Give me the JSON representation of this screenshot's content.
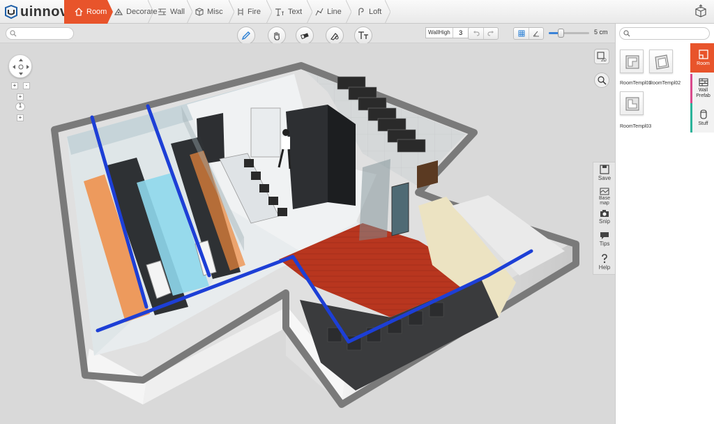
{
  "app": {
    "name": "uinnova"
  },
  "tabs": [
    {
      "label": "Room",
      "icon": "home-icon",
      "active": true
    },
    {
      "label": "Decorate",
      "icon": "decorate-icon",
      "active": false
    },
    {
      "label": "Wall",
      "icon": "wall-icon",
      "active": false
    },
    {
      "label": "Misc",
      "icon": "cube-icon",
      "active": false
    },
    {
      "label": "Fire",
      "icon": "fire-icon",
      "active": false
    },
    {
      "label": "Text",
      "icon": "text-icon",
      "active": false
    },
    {
      "label": "Line",
      "icon": "line-icon",
      "active": false
    },
    {
      "label": "Loft",
      "icon": "loft-icon",
      "active": false
    }
  ],
  "toolbar": {
    "search_placeholder": "",
    "tools": [
      "pencil-icon",
      "hand-icon",
      "eraser-icon",
      "brush-icon",
      "text-style-icon"
    ],
    "wall_high_label": "WallHigh",
    "wall_high_value": "3",
    "scale_label": "5 cm",
    "zoom_level": 0.3
  },
  "viewport": {
    "zoom_controls": [
      "+",
      "-",
      "+",
      "1",
      "+"
    ],
    "side_tools": [
      {
        "label": "Save",
        "icon": "save-icon"
      },
      {
        "label": "Base map",
        "icon": "base-map-icon"
      },
      {
        "label": "Snip",
        "icon": "camera-icon"
      },
      {
        "label": "Tips",
        "icon": "tips-icon"
      },
      {
        "label": "Help",
        "icon": "help-icon"
      }
    ],
    "view_2d_label": "2D"
  },
  "right_panel": {
    "search_placeholder": "",
    "templates": [
      "RoomTempl01",
      "RoomTempl02",
      "RoomTempl03"
    ],
    "tabs": [
      {
        "label": "Room",
        "active": true,
        "color": "#e8542b"
      },
      {
        "label": "Wall Prefab",
        "active": false,
        "color": "#d94a8c"
      },
      {
        "label": "Stuff",
        "active": false,
        "color": "#2bb39a"
      }
    ]
  },
  "colors": {
    "accent": "#e8542b",
    "pipe": "#1d3fd6",
    "floor_red": "#b8361f"
  }
}
